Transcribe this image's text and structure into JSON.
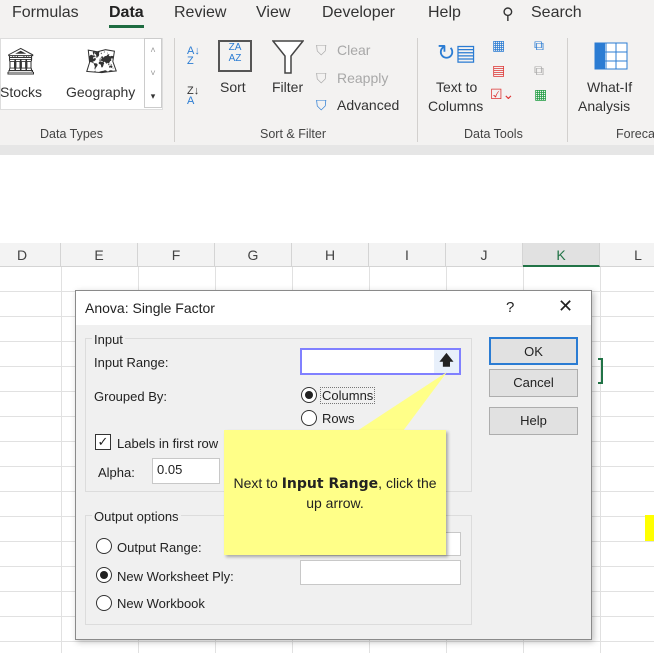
{
  "ribbon": {
    "tabs": [
      {
        "label": "Formulas"
      },
      {
        "label": "Data",
        "active": true
      },
      {
        "label": "Review"
      },
      {
        "label": "View"
      },
      {
        "label": "Developer"
      },
      {
        "label": "Help"
      }
    ],
    "search_label": "Search",
    "data_types": {
      "stocks": "Stocks",
      "geography": "Geography",
      "group": "Data Types"
    },
    "sort_filter": {
      "sort": "Sort",
      "filter": "Filter",
      "clear": "Clear",
      "reapply": "Reapply",
      "advanced": "Advanced",
      "group": "Sort & Filter",
      "az": "A Z",
      "za": "Z A"
    },
    "data_tools": {
      "text_to_columns_1": "Text to",
      "text_to_columns_2": "Columns",
      "group": "Data Tools"
    },
    "forecast": {
      "whatif_1": "What-If",
      "whatif_2": "Analysis",
      "group": "Foreca"
    }
  },
  "sheet": {
    "columns": [
      "D",
      "E",
      "F",
      "G",
      "H",
      "I",
      "J",
      "K",
      "L"
    ],
    "selected_column": "K"
  },
  "dialog": {
    "title": "Anova: Single Factor",
    "help_glyph": "?",
    "input_group": "Input",
    "input_range_label": "Input Range:",
    "input_range_value": "",
    "grouped_by_label": "Grouped By:",
    "columns_label": "Columns",
    "rows_label": "Rows",
    "grouped_by_selected": "Columns",
    "labels_first_row": "Labels in first row",
    "labels_checked": true,
    "alpha_label": "Alpha:",
    "alpha_value": "0.05",
    "output_group": "Output options",
    "output_range_label": "Output Range:",
    "new_worksheet_label": "New Worksheet Ply:",
    "new_workbook_label": "New Workbook",
    "output_selected": "New Worksheet Ply",
    "ok": "OK",
    "cancel": "Cancel",
    "help": "Help"
  },
  "callout": {
    "prefix": "Next to ",
    "bold": "Input Range",
    "suffix": ", click the up arrow."
  },
  "colors": {
    "accent": "#217346",
    "callout": "#ffff88",
    "focus": "#7b7bff"
  }
}
